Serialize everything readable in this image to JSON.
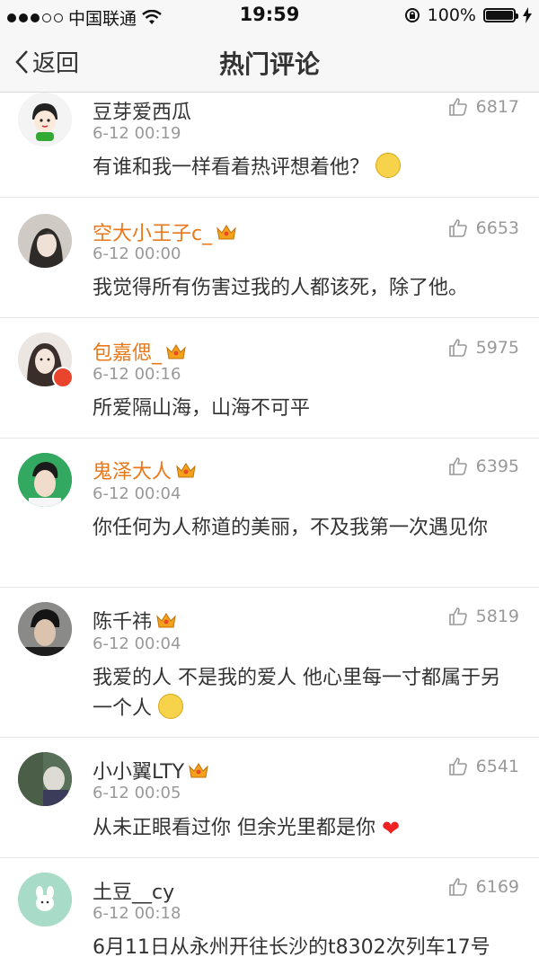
{
  "status_bar": {
    "carrier": "中国联通",
    "time": "19:59",
    "battery": "100%"
  },
  "nav": {
    "back_label": "返回",
    "title": "热门评论"
  },
  "comments": [
    {
      "name": "豆芽爱西瓜",
      "time": "6-12 00:19",
      "likes": "6817",
      "text": "有谁和我一样看着热评想着他？"
    },
    {
      "name": "空大小王子c_",
      "time": "6-12 00:00",
      "likes": "6653",
      "text": "我觉得所有伤害过我的人都该死，除了他。"
    },
    {
      "name": "包嘉偲_",
      "time": "6-12 00:16",
      "likes": "5975",
      "text": "所爱隔山海，山海不可平"
    },
    {
      "name": "鬼泽大人",
      "time": "6-12 00:04",
      "likes": "6395",
      "text": "你任何为人称道的美丽，不及我第一次遇见你"
    },
    {
      "name": "陈千祎",
      "time": "6-12 00:04",
      "likes": "5819",
      "text": "我爱的人 不是我的爱人 他心里每一寸都属于另一个人"
    },
    {
      "name": "小小翼LTY",
      "time": "6-12 00:05",
      "likes": "6541",
      "text": "从未正眼看过你 但余光里都是你"
    },
    {
      "name": "土豆__cy",
      "time": "6-12 00:18",
      "likes": "6169",
      "text": "6月11日从永州开往长沙的t8302次列车17号"
    }
  ]
}
